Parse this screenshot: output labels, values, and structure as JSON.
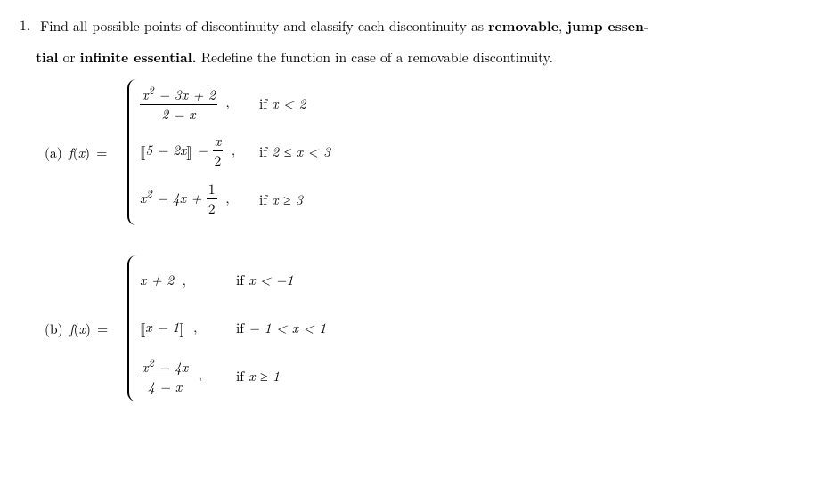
{
  "problem": {
    "number": "1.",
    "statement_pre": "Find all possible points of discontinuity and classify each discontinuity as ",
    "term_removable": "removable",
    "sep1": ", ",
    "term_jump": "jump essen-",
    "term_jump2": "tial",
    "sep2": " or ",
    "term_inf": "infinite essential.",
    "statement_post": " Redefine the function in case of a removable discontinuity.",
    "parts": {
      "a": {
        "label": "(a)",
        "lhs_fx": "f",
        "lhs_x": "x",
        "eq": "=",
        "cases": [
          {
            "expr_num_a": "x",
            "expr_num_sup": "2",
            "expr_num_rest": " − 3x + 2",
            "expr_den": "2 − x",
            "cond_pre": "if  ",
            "cond": "x < 2"
          },
          {
            "expr_floor_inner_a": "5 − 2",
            "expr_floor_inner_b": "x",
            "expr_minus": " − ",
            "expr_frac_num": "x",
            "expr_frac_den": "2",
            "cond_pre": "if  ",
            "cond": "2 ≤ x < 3"
          },
          {
            "expr_a": "x",
            "expr_sup": "2",
            "expr_rest": " − 4x + ",
            "expr_frac_num": "1",
            "expr_frac_den": "2",
            "cond_pre": "if  ",
            "cond": "x ≥ 3"
          }
        ]
      },
      "b": {
        "label": "(b)",
        "lhs_fx": "f",
        "lhs_x": "x",
        "eq": "=",
        "cases": [
          {
            "expr": "x + 2",
            "cond_pre": "if  ",
            "cond": "x < −1"
          },
          {
            "expr_floor_inner": "x − 1",
            "cond_pre": "if  ",
            "cond": "− 1 < x < 1"
          },
          {
            "expr_num_a": "x",
            "expr_num_sup": "2",
            "expr_num_rest": " − 4x",
            "expr_den": "4 − x",
            "cond_pre": "if  ",
            "cond": "x ≥ 1"
          }
        ]
      }
    }
  }
}
